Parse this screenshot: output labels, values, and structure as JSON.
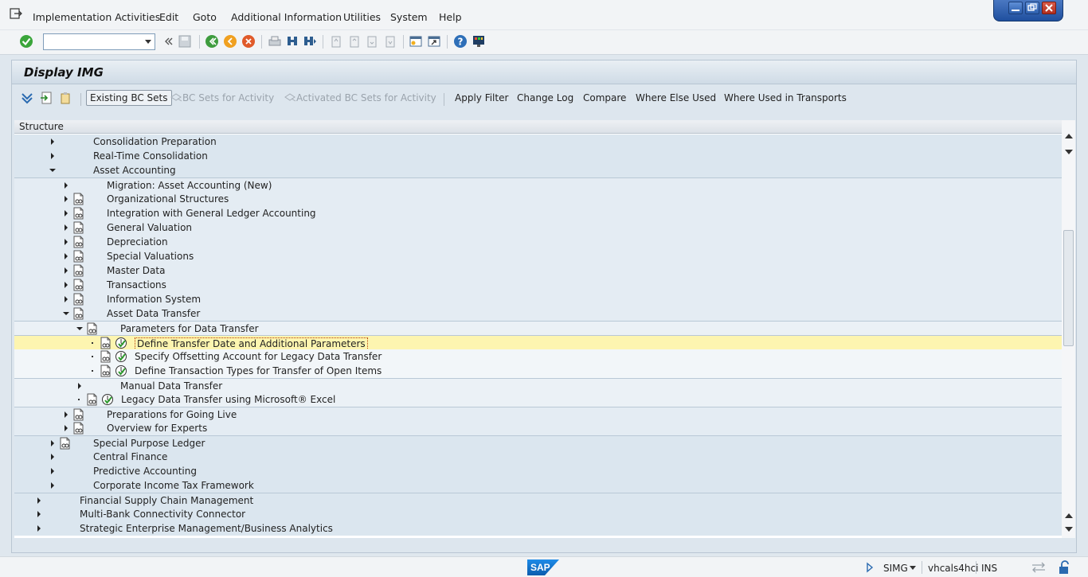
{
  "menu": {
    "items": [
      "Implementation Activities",
      "Edit",
      "Goto",
      "Additional Information",
      "Utilities",
      "System",
      "Help"
    ]
  },
  "toolbar": {
    "command_field_value": ""
  },
  "screen": {
    "title": "Display IMG"
  },
  "app_toolbar": {
    "existing_bc_sets": "Existing BC Sets",
    "bc_sets_for_activity": "BC Sets for Activity",
    "activated_bc_sets": "Activated BC Sets for Activity",
    "apply_filter": "Apply Filter",
    "change_log": "Change Log",
    "compare": "Compare",
    "where_else_used": "Where Else Used",
    "where_used_transports": "Where Used in Transports"
  },
  "tree": {
    "header": "Structure",
    "rows": [
      {
        "label": "Consolidation Preparation",
        "level": 2,
        "state": "collapsed",
        "doc": false,
        "activity": false
      },
      {
        "label": "Real-Time Consolidation",
        "level": 2,
        "state": "collapsed",
        "doc": false,
        "activity": false
      },
      {
        "label": "Asset Accounting",
        "level": 2,
        "state": "expanded",
        "doc": false,
        "activity": false
      },
      {
        "label": "Migration: Asset Accounting (New)",
        "level": 3,
        "state": "collapsed",
        "doc": false,
        "activity": false
      },
      {
        "label": "Organizational Structures",
        "level": 3,
        "state": "collapsed",
        "doc": true,
        "activity": false
      },
      {
        "label": "Integration with General Ledger Accounting",
        "level": 3,
        "state": "collapsed",
        "doc": true,
        "activity": false
      },
      {
        "label": "General Valuation",
        "level": 3,
        "state": "collapsed",
        "doc": true,
        "activity": false
      },
      {
        "label": "Depreciation",
        "level": 3,
        "state": "collapsed",
        "doc": true,
        "activity": false
      },
      {
        "label": "Special Valuations",
        "level": 3,
        "state": "collapsed",
        "doc": true,
        "activity": false
      },
      {
        "label": "Master Data",
        "level": 3,
        "state": "collapsed",
        "doc": true,
        "activity": false
      },
      {
        "label": "Transactions",
        "level": 3,
        "state": "collapsed",
        "doc": true,
        "activity": false
      },
      {
        "label": "Information System",
        "level": 3,
        "state": "collapsed",
        "doc": true,
        "activity": false
      },
      {
        "label": "Asset Data Transfer",
        "level": 3,
        "state": "expanded",
        "doc": true,
        "activity": false
      },
      {
        "label": "Parameters for Data Transfer",
        "level": 4,
        "state": "expanded",
        "doc": true,
        "activity": false
      },
      {
        "label": "Define Transfer Date and Additional Parameters",
        "level": 5,
        "state": "leaf",
        "doc": true,
        "activity": true,
        "selected": true
      },
      {
        "label": "Specify Offsetting Account for Legacy Data Transfer",
        "level": 5,
        "state": "leaf",
        "doc": true,
        "activity": true
      },
      {
        "label": "Define Transaction Types for Transfer of Open Items",
        "level": 5,
        "state": "leaf",
        "doc": true,
        "activity": true
      },
      {
        "label": "Manual Data Transfer",
        "level": 4,
        "state": "collapsed",
        "doc": false,
        "activity": false
      },
      {
        "label": "Legacy Data Transfer using Microsoft® Excel",
        "level": 4,
        "state": "leaf",
        "doc": true,
        "activity": true
      },
      {
        "label": "Preparations for Going Live",
        "level": 3,
        "state": "collapsed",
        "doc": true,
        "activity": false
      },
      {
        "label": "Overview for Experts",
        "level": 3,
        "state": "collapsed",
        "doc": true,
        "activity": false
      },
      {
        "label": "Special Purpose Ledger",
        "level": 2,
        "state": "collapsed",
        "doc": true,
        "activity": false
      },
      {
        "label": "Central Finance",
        "level": 2,
        "state": "collapsed",
        "doc": false,
        "activity": false
      },
      {
        "label": "Predictive Accounting",
        "level": 2,
        "state": "collapsed",
        "doc": false,
        "activity": false
      },
      {
        "label": "Corporate Income Tax Framework",
        "level": 2,
        "state": "collapsed",
        "doc": false,
        "activity": false
      },
      {
        "label": "Financial Supply Chain Management",
        "level": 1,
        "state": "collapsed",
        "doc": false,
        "activity": false
      },
      {
        "label": "Multi-Bank Connectivity Connector",
        "level": 1,
        "state": "collapsed",
        "doc": false,
        "activity": false
      },
      {
        "label": "Strategic Enterprise Management/Business Analytics",
        "level": 1,
        "state": "collapsed",
        "doc": false,
        "activity": false
      }
    ]
  },
  "status": {
    "transaction": "SIMG",
    "server": "vhcals4hci",
    "mode": "INS",
    "logo_text": "SAP"
  },
  "colors": {
    "selection": "#fdf5b0",
    "tree_bg": "#dbe6ef",
    "accent": "#1e8be8"
  }
}
